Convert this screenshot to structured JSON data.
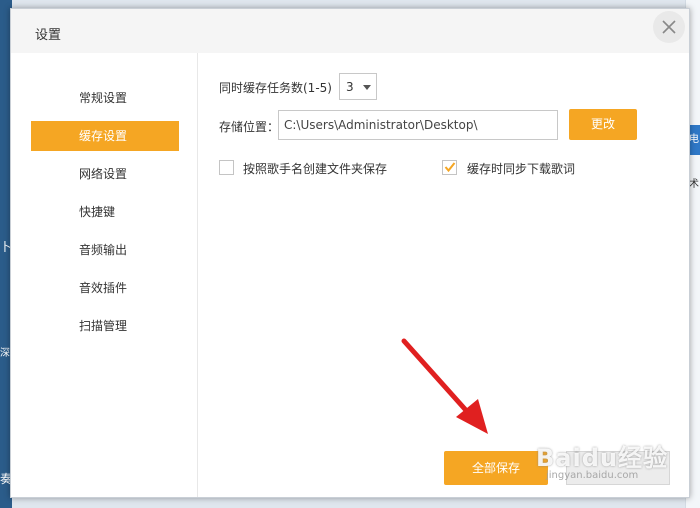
{
  "background": {
    "left_texts": [
      "卜",
      "深",
      "奏"
    ],
    "right_badge": "电",
    "right_text": "术"
  },
  "dialog": {
    "title": "设置",
    "close_glyph": "✕"
  },
  "sidebar": {
    "items": [
      {
        "label": "常规设置",
        "active": false
      },
      {
        "label": "缓存设置",
        "active": true
      },
      {
        "label": "网络设置",
        "active": false
      },
      {
        "label": "快捷键",
        "active": false
      },
      {
        "label": "音频输出",
        "active": false
      },
      {
        "label": "音效插件",
        "active": false
      },
      {
        "label": "扫描管理",
        "active": false
      }
    ]
  },
  "cache": {
    "task_count_label": "同时缓存任务数(1-5)",
    "task_count_value": "3",
    "storage_label": "存储位置：",
    "storage_path": "C:\\Users\\Administrator\\Desktop\\",
    "change_button": "更改",
    "option_folder_by_singer": {
      "label": "按照歌手名创建文件夹保存",
      "checked": false
    },
    "option_sync_lyrics": {
      "label": "缓存时同步下载歌词",
      "checked": true
    }
  },
  "footer": {
    "save_all_button": "全部保存",
    "watermark": "Baidu经验",
    "watermark_sub": "jingyan.baidu.com"
  },
  "colors": {
    "accent": "#f5a623",
    "annotation_arrow": "#e02020"
  }
}
